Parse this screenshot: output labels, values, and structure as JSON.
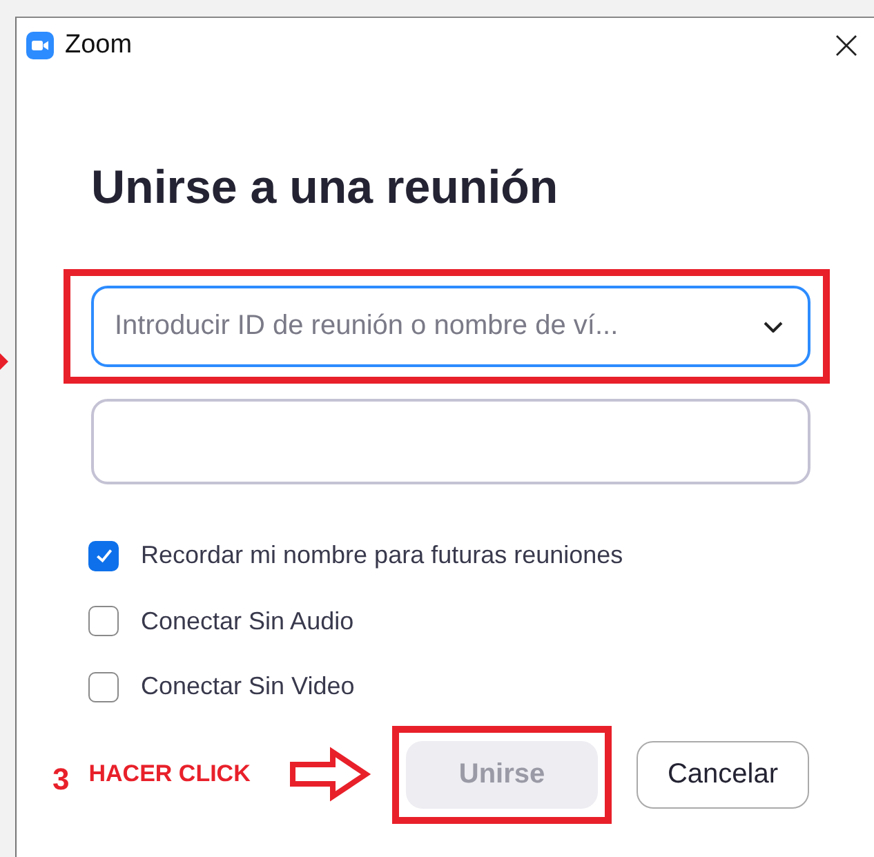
{
  "window": {
    "title": "Zoom"
  },
  "heading": "Unirse a una reunión",
  "meeting_field": {
    "placeholder": "Introducir ID de reunión o nombre de ví...",
    "highlighted": true
  },
  "options": [
    {
      "label": "Recordar mi nombre para futuras reuniones",
      "checked": true
    },
    {
      "label": "Conectar Sin Audio",
      "checked": false
    },
    {
      "label": "Conectar Sin Video",
      "checked": false
    }
  ],
  "annotation": {
    "step": "3",
    "text": "HACER CLICK"
  },
  "buttons": [
    {
      "label": "Unirse",
      "kind": "primary",
      "disabled": true,
      "highlighted": true
    },
    {
      "label": "Cancelar",
      "kind": "secondary",
      "disabled": false,
      "highlighted": false
    }
  ]
}
